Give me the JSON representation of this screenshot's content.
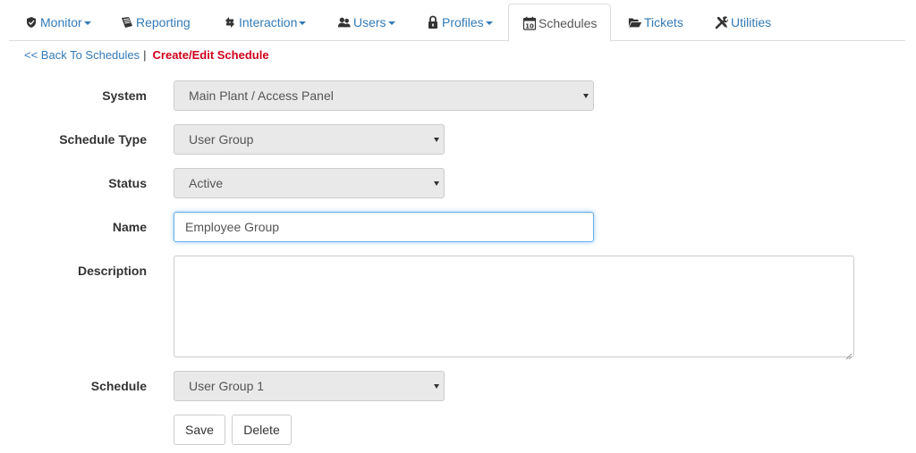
{
  "nav": {
    "items": [
      {
        "label": "Monitor",
        "icon": "shield-icon",
        "dropdown": true
      },
      {
        "label": "Reporting",
        "icon": "report-icon",
        "dropdown": false
      },
      {
        "label": "Interaction",
        "icon": "exchange-icon",
        "dropdown": true
      },
      {
        "label": "Users",
        "icon": "users-icon",
        "dropdown": true
      },
      {
        "label": "Profiles",
        "icon": "lock-icon",
        "dropdown": true
      },
      {
        "label": "Schedules",
        "icon": "calendar-icon",
        "dropdown": false,
        "active": true
      },
      {
        "label": "Tickets",
        "icon": "folder-open-icon",
        "dropdown": false
      },
      {
        "label": "Utilities",
        "icon": "tools-icon",
        "dropdown": false
      }
    ]
  },
  "breadcrumb": {
    "back": "<< Back To Schedules",
    "separator": "|",
    "current": "Create/Edit Schedule"
  },
  "form": {
    "system": {
      "label": "System",
      "value": "Main Plant / Access Panel"
    },
    "schedule_type": {
      "label": "Schedule Type",
      "value": "User Group"
    },
    "status": {
      "label": "Status",
      "value": "Active"
    },
    "name": {
      "label": "Name",
      "value": "Employee Group"
    },
    "description": {
      "label": "Description",
      "value": ""
    },
    "schedule": {
      "label": "Schedule",
      "value": "User Group 1"
    },
    "save_label": "Save",
    "delete_label": "Delete"
  },
  "colors": {
    "link": "#337ab7",
    "current_crumb": "#d0021b",
    "focus_border": "#66afe9",
    "select_bg": "#e9e9e9"
  }
}
